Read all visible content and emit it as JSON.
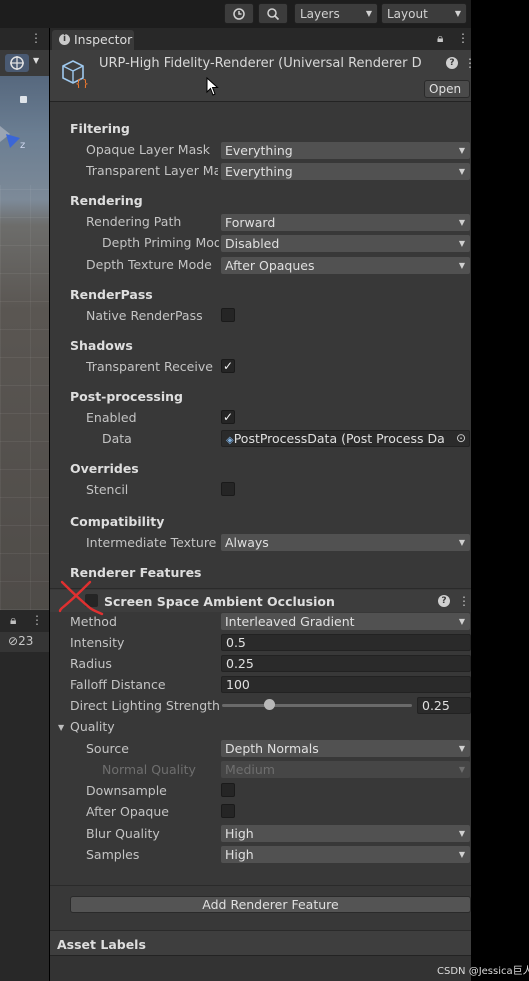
{
  "toolbar": {
    "layers_label": "Layers",
    "layout_label": "Layout"
  },
  "scene": {
    "visibility_count": "23",
    "axis_label": "z"
  },
  "inspector": {
    "tab_label": "Inspector",
    "asset_title": "URP-High Fidelity-Renderer (Universal Renderer D",
    "open_button": "Open"
  },
  "filtering": {
    "heading": "Filtering",
    "opaque_label": "Opaque Layer Mask",
    "opaque_value": "Everything",
    "transparent_label": "Transparent Layer Ma",
    "transparent_value": "Everything"
  },
  "rendering": {
    "heading": "Rendering",
    "path_label": "Rendering Path",
    "path_value": "Forward",
    "depth_priming_label": "Depth Priming Mod",
    "depth_priming_value": "Disabled",
    "depth_texture_label": "Depth Texture Mode",
    "depth_texture_value": "After Opaques"
  },
  "renderpass": {
    "heading": "RenderPass",
    "native_label": "Native RenderPass",
    "native_checked": false
  },
  "shadows": {
    "heading": "Shadows",
    "transparent_receive_label": "Transparent Receive",
    "transparent_receive_checked": true
  },
  "post_processing": {
    "heading": "Post-processing",
    "enabled_label": "Enabled",
    "enabled_checked": true,
    "data_label": "Data",
    "data_value": "PostProcessData (Post Process Da"
  },
  "overrides": {
    "heading": "Overrides",
    "stencil_label": "Stencil",
    "stencil_checked": false
  },
  "compatibility": {
    "heading": "Compatibility",
    "intermediate_label": "Intermediate Texture",
    "intermediate_value": "Always"
  },
  "renderer_features": {
    "heading": "Renderer Features",
    "feature_title": "Screen Space Ambient Occlusion",
    "method_label": "Method",
    "method_value": "Interleaved Gradient",
    "intensity_label": "Intensity",
    "intensity_value": "0.5",
    "radius_label": "Radius",
    "radius_value": "0.25",
    "falloff_label": "Falloff Distance",
    "falloff_value": "100",
    "direct_lighting_label": "Direct Lighting Strength",
    "direct_lighting_value": "0.25",
    "direct_lighting_fraction": 0.25,
    "quality_heading": "Quality",
    "source_label": "Source",
    "source_value": "Depth Normals",
    "normal_quality_label": "Normal Quality",
    "normal_quality_value": "Medium",
    "downsample_label": "Downsample",
    "downsample_checked": false,
    "after_opaque_label": "After Opaque",
    "after_opaque_checked": false,
    "blur_quality_label": "Blur Quality",
    "blur_quality_value": "High",
    "samples_label": "Samples",
    "samples_value": "High",
    "add_button": "Add Renderer Feature"
  },
  "asset_labels": {
    "heading": "Asset Labels"
  },
  "watermark": "CSDN @Jessica巨人",
  "colors": {
    "annotation_red": "#e03030",
    "panel_bg": "#383838",
    "field_bg": "#515151"
  }
}
